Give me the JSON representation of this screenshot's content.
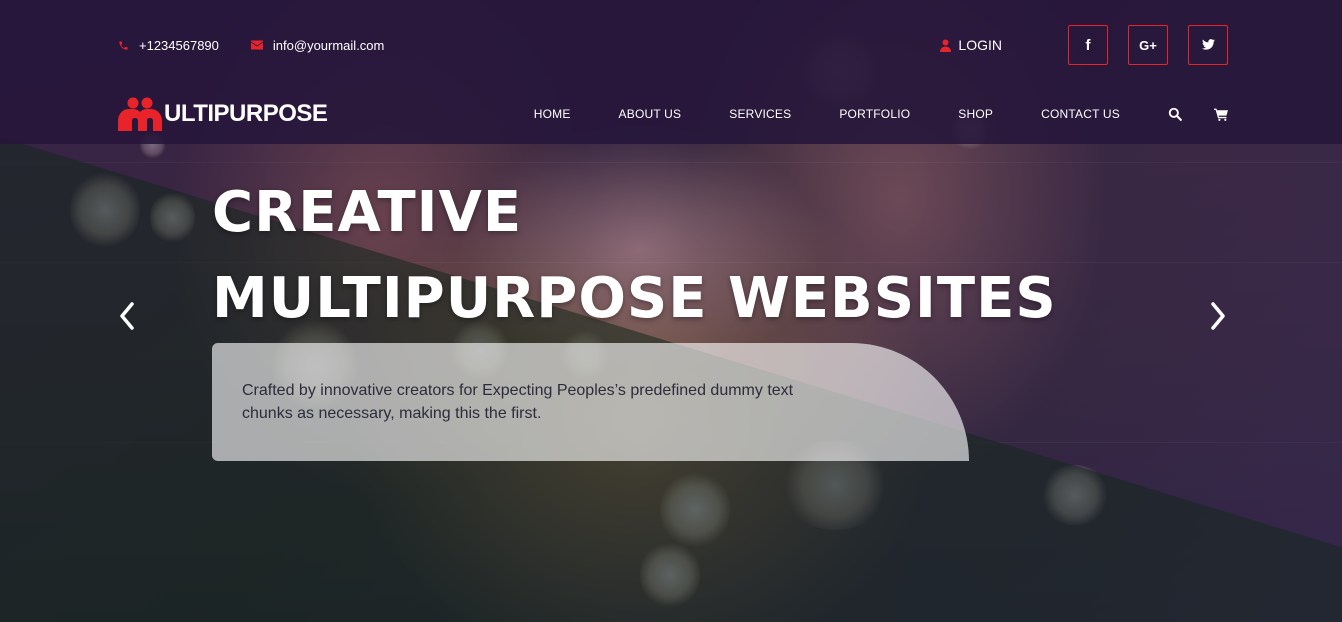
{
  "topbar": {
    "phone": "+1234567890",
    "email": "info@yourmail.com",
    "login_label": "LOGIN",
    "social": [
      {
        "name": "facebook",
        "glyph": "f"
      },
      {
        "name": "google-plus",
        "glyph": "G+"
      },
      {
        "name": "twitter",
        "glyph": "🐦"
      }
    ]
  },
  "brand": {
    "logo_text": "ULTIPURPOSE",
    "accent_color": "#e8232a"
  },
  "nav": {
    "items": [
      "HOME",
      "ABOUT US",
      "SERVICES",
      "PORTFOLIO",
      "SHOP",
      "CONTACT US"
    ],
    "icons": [
      "search-icon",
      "cart-icon"
    ]
  },
  "hero": {
    "title_line1": "CREATIVE",
    "title_line2": "MULTIPURPOSE WEBSITES",
    "description": "Crafted by innovative creators for Expecting Peoples’s predefined dummy text chunks as necessary, making this the first."
  },
  "slider": {
    "prev_icon": "chevron-left-icon",
    "next_icon": "chevron-right-icon"
  }
}
